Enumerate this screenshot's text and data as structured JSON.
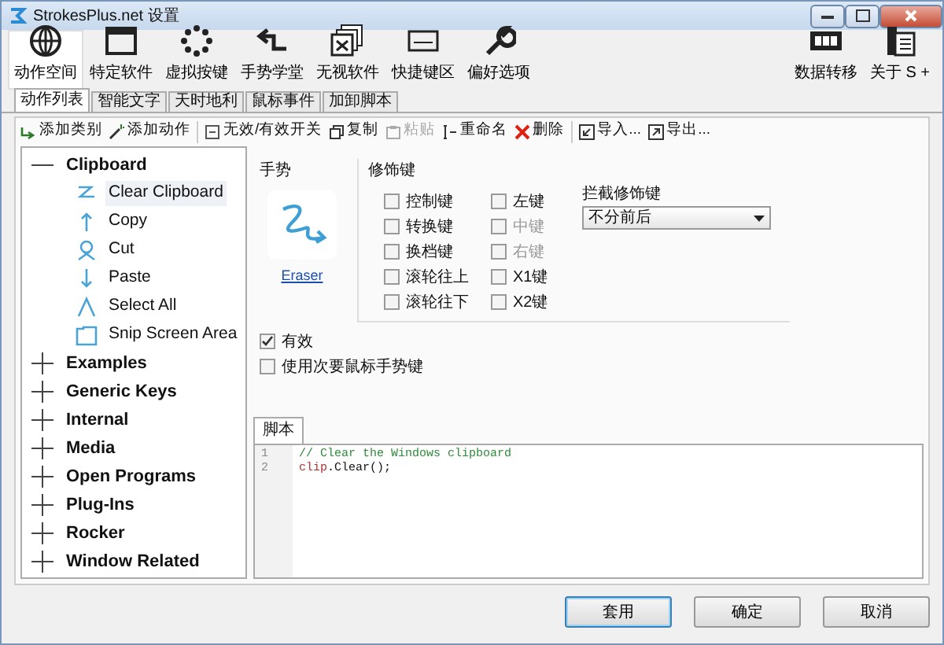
{
  "window": {
    "title": "StrokesPlus.net 设置"
  },
  "toolbar_left": [
    {
      "label": "动作空间",
      "selected": true
    },
    {
      "label": "特定软件",
      "selected": false
    },
    {
      "label": "虚拟按键",
      "selected": false
    },
    {
      "label": "手势学堂",
      "selected": false
    },
    {
      "label": "无视软件",
      "selected": false
    },
    {
      "label": "快捷键区",
      "selected": false
    },
    {
      "label": "偏好选项",
      "selected": false
    }
  ],
  "toolbar_right": [
    {
      "label": "数据转移",
      "selected": false
    },
    {
      "label": "关于 S +",
      "selected": false
    }
  ],
  "tabs": [
    {
      "label": "动作列表",
      "selected": true
    },
    {
      "label": "智能文字",
      "selected": false
    },
    {
      "label": "天时地利",
      "selected": false
    },
    {
      "label": "鼠标事件",
      "selected": false
    },
    {
      "label": "加卸脚本",
      "selected": false
    }
  ],
  "actions": [
    {
      "label": "添加类别",
      "disabled": false
    },
    {
      "label": "添加动作",
      "disabled": false
    },
    {
      "label": "无效/有效开关",
      "disabled": false
    },
    {
      "label": "复制",
      "disabled": false
    },
    {
      "label": "粘贴",
      "disabled": true
    },
    {
      "label": "重命名",
      "disabled": false
    },
    {
      "label": "删除",
      "disabled": false
    },
    {
      "label": "导入...",
      "disabled": false
    },
    {
      "label": "导出...",
      "disabled": false
    }
  ],
  "tree": [
    {
      "label": "Clipboard",
      "expanded": true,
      "children": [
        {
          "label": "Clear Clipboard",
          "selected": true
        },
        {
          "label": "Copy",
          "selected": false
        },
        {
          "label": "Cut",
          "selected": false
        },
        {
          "label": "Paste",
          "selected": false
        },
        {
          "label": "Select All",
          "selected": false
        },
        {
          "label": "Snip Screen Area",
          "selected": false
        }
      ]
    },
    {
      "label": "Examples",
      "expanded": false
    },
    {
      "label": "Generic Keys",
      "expanded": false
    },
    {
      "label": "Internal",
      "expanded": false
    },
    {
      "label": "Media",
      "expanded": false
    },
    {
      "label": "Open Programs",
      "expanded": false
    },
    {
      "label": "Plug-Ins",
      "expanded": false
    },
    {
      "label": "Rocker",
      "expanded": false
    },
    {
      "label": "Window Related",
      "expanded": false
    }
  ],
  "gesture": {
    "heading": "手势",
    "name": "Eraser"
  },
  "modifiers": {
    "heading": "修饰键",
    "keys": [
      {
        "label": "控制键",
        "checked": false,
        "disabled": false
      },
      {
        "label": "转换键",
        "checked": false,
        "disabled": false
      },
      {
        "label": "换档键",
        "checked": false,
        "disabled": false
      },
      {
        "label": "滚轮往上",
        "checked": false,
        "disabled": false
      },
      {
        "label": "滚轮往下",
        "checked": false,
        "disabled": false
      },
      {
        "label": "左键",
        "checked": false,
        "disabled": false
      },
      {
        "label": "中键",
        "checked": false,
        "disabled": true
      },
      {
        "label": "右键",
        "checked": false,
        "disabled": true
      },
      {
        "label": "X1键",
        "checked": false,
        "disabled": false
      },
      {
        "label": "X2键",
        "checked": false,
        "disabled": false
      }
    ]
  },
  "intercept": {
    "label": "拦截修饰键",
    "value": "不分前后"
  },
  "options": [
    {
      "label": "有效",
      "checked": true
    },
    {
      "label": "使用次要鼠标手势键",
      "checked": false
    }
  ],
  "script": {
    "tab": "脚本",
    "lines": [
      {
        "number": "1",
        "tokens": [
          {
            "text": "// Clear the Windows clipboard",
            "kind": "comment"
          }
        ]
      },
      {
        "number": "2",
        "tokens": [
          {
            "text": "clip",
            "kind": "object"
          },
          {
            "text": ".Clear();",
            "kind": "plain"
          }
        ]
      }
    ]
  },
  "buttons": [
    {
      "label": "套用",
      "default": true
    },
    {
      "label": "确定",
      "default": false
    },
    {
      "label": "取消",
      "default": false
    }
  ]
}
